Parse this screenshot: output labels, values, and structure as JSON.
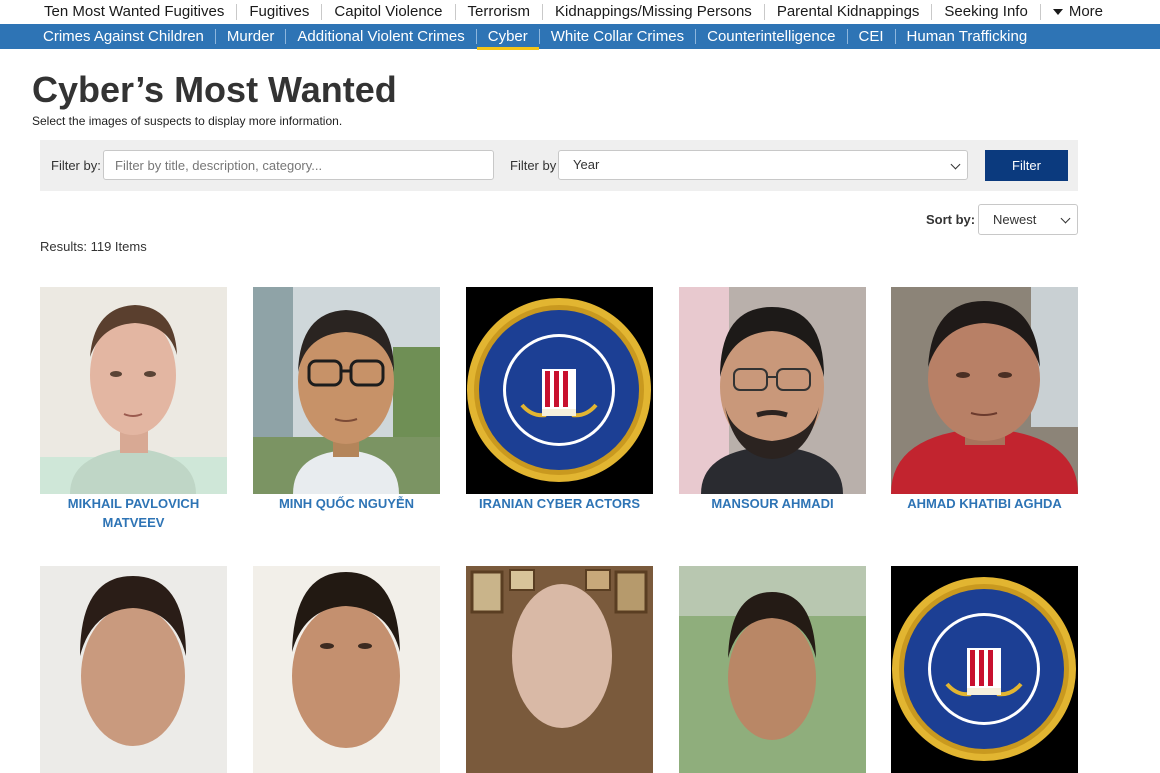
{
  "top_nav": {
    "items": [
      "Ten Most Wanted Fugitives",
      "Fugitives",
      "Capitol Violence",
      "Terrorism",
      "Kidnappings/Missing Persons",
      "Parental Kidnappings",
      "Seeking Info"
    ],
    "more_label": "More"
  },
  "sub_nav": {
    "items": [
      "Crimes Against Children",
      "Murder",
      "Additional Violent Crimes",
      "Cyber",
      "White Collar Crimes",
      "Counterintelligence",
      "CEI",
      "Human Trafficking"
    ],
    "active": "Cyber"
  },
  "page": {
    "title": "Cyber’s Most Wanted",
    "subtitle": "Select the images of suspects to display more information."
  },
  "filter": {
    "label1": "Filter by:",
    "placeholder": "Filter by title, description, category...",
    "label2": "Filter by",
    "year_value": "Year",
    "button": "Filter"
  },
  "sort": {
    "label": "Sort by:",
    "value": "Newest"
  },
  "results_text": "Results: 119 Items",
  "cards_row1": [
    {
      "name": "MIKHAIL PAVLOVICH MATVEEV",
      "image": "man-portrait-light-bg"
    },
    {
      "name": "MINH QUỐC NGUYỄN",
      "image": "man-with-glasses-outdoor"
    },
    {
      "name": "IRANIAN CYBER ACTORS",
      "image": "fbi-seal"
    },
    {
      "name": "MANSOUR AHMADI",
      "image": "man-with-glasses-beard"
    },
    {
      "name": "AHMAD KHATIBI AGHDA",
      "image": "man-red-shirt"
    }
  ],
  "cards_row2": [
    {
      "image": "man-portrait"
    },
    {
      "image": "man-portrait"
    },
    {
      "image": "man-bald-portrait"
    },
    {
      "image": "man-outdoor-portrait"
    },
    {
      "image": "fbi-seal"
    }
  ],
  "colors": {
    "subnav_bg": "#2e74b5",
    "active_underline": "#f5c518",
    "button_bg": "#0b3a7e",
    "name_link": "#2e74b5"
  }
}
